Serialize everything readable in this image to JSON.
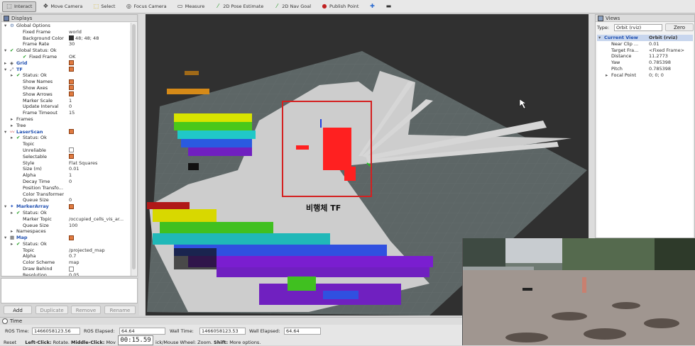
{
  "toolbar": {
    "tools": [
      {
        "label": "Interact",
        "icon": "interact-icon"
      },
      {
        "label": "Move Camera",
        "icon": "move-camera-icon"
      },
      {
        "label": "Select",
        "icon": "select-icon"
      },
      {
        "label": "Focus Camera",
        "icon": "focus-camera-icon"
      },
      {
        "label": "Measure",
        "icon": "measure-icon"
      },
      {
        "label": "2D Pose Estimate",
        "icon": "pose-estimate-icon"
      },
      {
        "label": "2D Nav Goal",
        "icon": "nav-goal-icon"
      },
      {
        "label": "Publish Point",
        "icon": "publish-point-icon"
      }
    ]
  },
  "displays": {
    "title": "Displays",
    "rows": [
      {
        "k": "Global Options",
        "v": ""
      },
      {
        "k": "Fixed Frame",
        "v": "world"
      },
      {
        "k": "Background Color",
        "v": "48; 48; 48"
      },
      {
        "k": "Frame Rate",
        "v": "30"
      },
      {
        "k": "Global Status: Ok",
        "v": ""
      },
      {
        "k": "Fixed Frame",
        "v": "OK"
      },
      {
        "k": "Grid",
        "v": ""
      },
      {
        "k": "TF",
        "v": ""
      },
      {
        "k": "Status: Ok",
        "v": ""
      },
      {
        "k": "Show Names",
        "v": ""
      },
      {
        "k": "Show Axes",
        "v": ""
      },
      {
        "k": "Show Arrows",
        "v": ""
      },
      {
        "k": "Marker Scale",
        "v": "1"
      },
      {
        "k": "Update Interval",
        "v": "0"
      },
      {
        "k": "Frame Timeout",
        "v": "15"
      },
      {
        "k": "Frames",
        "v": ""
      },
      {
        "k": "Tree",
        "v": ""
      },
      {
        "k": "LaserScan",
        "v": ""
      },
      {
        "k": "Status: Ok",
        "v": ""
      },
      {
        "k": "Topic",
        "v": ""
      },
      {
        "k": "Unreliable",
        "v": ""
      },
      {
        "k": "Selectable",
        "v": ""
      },
      {
        "k": "Style",
        "v": "Flat Squares"
      },
      {
        "k": "Size (m)",
        "v": "0.01"
      },
      {
        "k": "Alpha",
        "v": "1"
      },
      {
        "k": "Decay Time",
        "v": "0"
      },
      {
        "k": "Position Transfo...",
        "v": ""
      },
      {
        "k": "Color Transformer",
        "v": ""
      },
      {
        "k": "Queue Size",
        "v": "0"
      },
      {
        "k": "MarkerArray",
        "v": ""
      },
      {
        "k": "Status: Ok",
        "v": ""
      },
      {
        "k": "Marker Topic",
        "v": "/occupied_cells_vis_ar..."
      },
      {
        "k": "Queue Size",
        "v": "100"
      },
      {
        "k": "Namespaces",
        "v": ""
      },
      {
        "k": "Map",
        "v": ""
      },
      {
        "k": "Status: Ok",
        "v": ""
      },
      {
        "k": "Topic",
        "v": "/projected_map"
      },
      {
        "k": "Alpha",
        "v": "0.7"
      },
      {
        "k": "Color Scheme",
        "v": "map"
      },
      {
        "k": "Draw Behind",
        "v": ""
      },
      {
        "k": "Resolution",
        "v": "0.05"
      }
    ],
    "buttons": {
      "add": "Add",
      "duplicate": "Duplicate",
      "remove": "Remove",
      "rename": "Rename"
    }
  },
  "views": {
    "title": "Views",
    "type_label": "Type:",
    "type_value": "Orbit (rviz)",
    "zero": "Zero",
    "rows": [
      {
        "k": "Current View",
        "v": "Orbit (rviz)"
      },
      {
        "k": "Near Clip ...",
        "v": "0.01"
      },
      {
        "k": "Target Fra...",
        "v": "<Fixed Frame>"
      },
      {
        "k": "Distance",
        "v": "11.2773"
      },
      {
        "k": "Yaw",
        "v": "0.785398"
      },
      {
        "k": "Pitch",
        "v": "0.785398"
      },
      {
        "k": "Focal Point",
        "v": "0; 0; 0"
      }
    ]
  },
  "viewport": {
    "annotation": "비행체 TF",
    "annotation_color": "#d42020"
  },
  "time": {
    "title": "Time",
    "ros_time_label": "ROS Time:",
    "ros_time": "1466058123.56",
    "ros_elapsed_label": "ROS Elapsed:",
    "ros_elapsed": "64.64",
    "wall_time_label": "Wall Time:",
    "wall_time": "1466058123.53",
    "wall_elapsed_label": "Wall Elapsed:",
    "wall_elapsed": "64.64"
  },
  "status": {
    "reset": "Reset",
    "hint_a": "Left-Click:",
    "hint_a_text": "Rotate.",
    "hint_b": "Middle-Click:",
    "hint_b_text": "Mov",
    "hint_c": "ick/Mouse Wheel:",
    "hint_c_text": "Zoom.",
    "hint_d": "Shift:",
    "hint_d_text": "More options."
  },
  "timer": "00:15.59"
}
